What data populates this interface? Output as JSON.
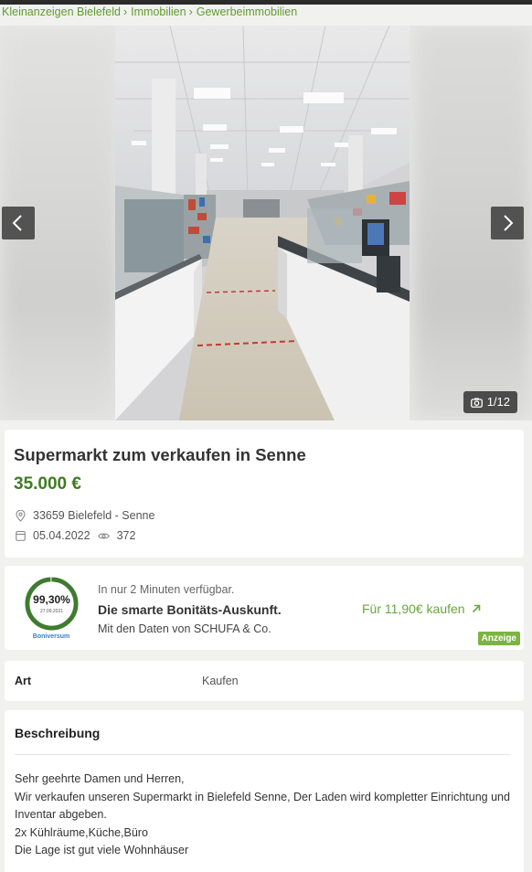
{
  "breadcrumb": [
    "Kleinanzeigen Bielefeld",
    "Immobilien",
    "Gewerbeimmobilien"
  ],
  "gallery": {
    "counter": "1/12",
    "prev_icon": "chevron-left-icon",
    "next_icon": "chevron-right-icon",
    "camera_icon": "camera-icon"
  },
  "listing": {
    "title": "Supermarkt zum verkaufen in Senne",
    "price": "35.000 €",
    "location": "33659 Bielefeld - Senne",
    "date": "05.04.2022",
    "views": "372"
  },
  "ad": {
    "score": "99,30%",
    "score_date": "27.09.2021",
    "brand": "Boniversum",
    "line1": "In nur 2 Minuten verfügbar.",
    "line2": "Die smarte Bonitäts-Auskunft.",
    "line3": "Mit den Daten von SCHUFA & Co.",
    "cta": "Für 11,90€ kaufen",
    "badge": "Anzeige"
  },
  "details": {
    "label": "Art",
    "value": "Kaufen"
  },
  "description": {
    "heading": "Beschreibung",
    "lines": [
      "Sehr geehrte Damen und Herren,",
      "Wir verkaufen unseren Supermarkt in Bielefeld Senne, Der Laden wird kompletter Einrichtung und Inventar abgeben.",
      "2x Kühlräume,Küche,Büro",
      "Die Lage ist gut viele Wohnhäuser"
    ]
  },
  "colors": {
    "accent": "#3f7b23",
    "link": "#5f9c32",
    "badge": "#7cb342"
  }
}
